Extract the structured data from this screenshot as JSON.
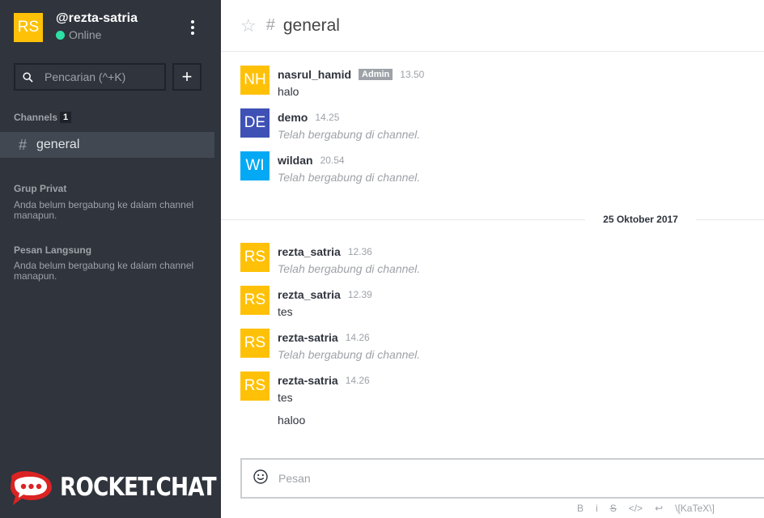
{
  "sidebar": {
    "user": {
      "initials": "RS",
      "name": "@rezta-satria",
      "status": "Online",
      "avatar_color": "#ffc107"
    },
    "search": {
      "placeholder": "Pencarian (^+K)"
    },
    "add_label": "+",
    "channels": {
      "title": "Channels",
      "count": "1",
      "items": [
        {
          "label": "general"
        }
      ]
    },
    "private_groups": {
      "title": "Grup Privat",
      "empty": "Anda belum bergabung ke dalam channel manapun."
    },
    "direct_messages": {
      "title": "Pesan Langsung",
      "empty": "Anda belum bergabung ke dalam channel manapun."
    },
    "logo_text": "ROCKET.CHAT",
    "logo_color": "#db2323"
  },
  "header": {
    "title": "general"
  },
  "messages": [
    {
      "initials": "NH",
      "user": "nasrul_hamid",
      "badge": "Admin",
      "time": "13.50",
      "text": "halo",
      "avatar_color": "#ffc107"
    },
    {
      "initials": "DE",
      "user": "demo",
      "time": "14.25",
      "text": "Telah bergabung di channel.",
      "avatar_color": "#3f51b5"
    },
    {
      "initials": "WI",
      "user": "wildan",
      "time": "20.54",
      "text": "Telah bergabung di channel.",
      "avatar_color": "#03a9f4"
    },
    {
      "initials": "RS",
      "user": "rezta_satria",
      "time": "12.36",
      "text": "Telah bergabung di channel.",
      "avatar_color": "#ffc107"
    },
    {
      "initials": "RS",
      "user": "rezta_satria",
      "time": "12.39",
      "text": "tes",
      "avatar_color": "#ffc107"
    },
    {
      "initials": "RS",
      "user": "rezta-satria",
      "time": "14.26",
      "text": "Telah bergabung di channel.",
      "avatar_color": "#ffc107"
    },
    {
      "initials": "RS",
      "user": "rezta-satria",
      "time": "14.26",
      "text": "tes",
      "extra": "haloo",
      "avatar_color": "#ffc107"
    }
  ],
  "date_separator": "25 Oktober 2017",
  "composer": {
    "placeholder": "Pesan",
    "format": {
      "bold": "B",
      "italic": "i",
      "strike": "S",
      "code": "</>",
      "newline": "↩",
      "katex": "\\[KaTeX\\]"
    }
  }
}
